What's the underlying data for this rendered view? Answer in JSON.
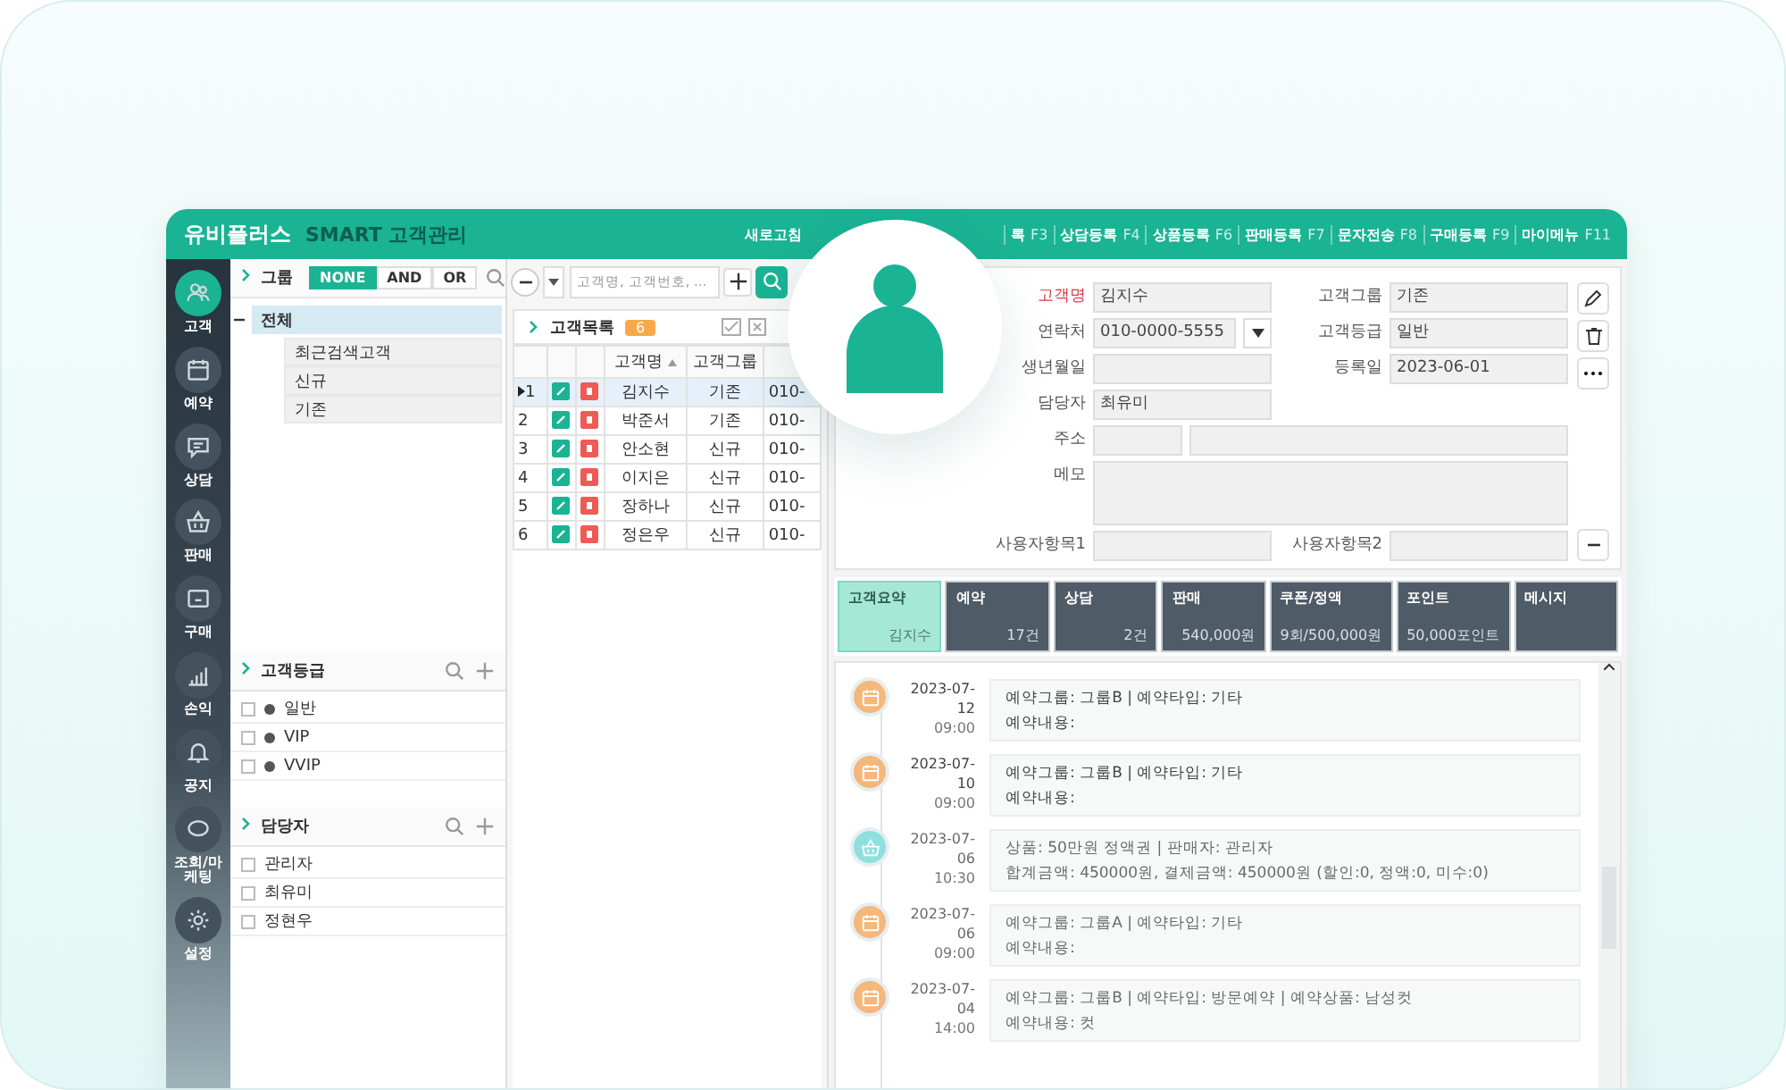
{
  "app": {
    "logo": "유비플러스",
    "subtitle": "SMART 고객관리"
  },
  "top_menu": [
    {
      "label": "새로고침"
    },
    {
      "label": "록",
      "key": "F3"
    },
    {
      "label": "상담등록",
      "key": "F4"
    },
    {
      "label": "상품등록",
      "key": "F6"
    },
    {
      "label": "판매등록",
      "key": "F7"
    },
    {
      "label": "문자전송",
      "key": "F8"
    },
    {
      "label": "구매등록",
      "key": "F9"
    },
    {
      "label": "마이메뉴",
      "key": "F11"
    }
  ],
  "nav": [
    {
      "label": "고객",
      "kind": "people",
      "selected": true
    },
    {
      "label": "예약",
      "kind": "calendar",
      "selected": false
    },
    {
      "label": "상담",
      "kind": "chat",
      "selected": false
    },
    {
      "label": "판매",
      "kind": "basket",
      "selected": false
    },
    {
      "label": "구매",
      "kind": "box",
      "selected": false
    },
    {
      "label": "손익",
      "kind": "chart",
      "selected": false
    },
    {
      "label": "공지",
      "kind": "bell",
      "selected": false
    },
    {
      "label": "조회/마케팅",
      "kind": "sms",
      "selected": false
    },
    {
      "label": "설정",
      "kind": "gear",
      "selected": false
    }
  ],
  "group_panel": {
    "title": "그룹",
    "modes": [
      {
        "label": "NONE",
        "selected": true
      },
      {
        "label": "AND",
        "selected": false
      },
      {
        "label": "OR",
        "selected": false
      }
    ],
    "tree": [
      {
        "label": "전체",
        "selected": true,
        "expanded": true,
        "children": [
          {
            "label": "최근검색고객",
            "selected": false
          },
          {
            "label": "신규",
            "selected": false
          },
          {
            "label": "기존",
            "selected": false
          }
        ]
      }
    ]
  },
  "grade_panel": {
    "title": "고객등급",
    "items": [
      {
        "label": "일반",
        "checked": false,
        "color": "#555555"
      },
      {
        "label": "VIP",
        "checked": false,
        "color": "#555555"
      },
      {
        "label": "VVIP",
        "checked": false,
        "color": "#555555"
      }
    ]
  },
  "manager_panel": {
    "title": "담당자",
    "items": [
      {
        "label": "관리자",
        "checked": false
      },
      {
        "label": "최유미",
        "checked": false
      },
      {
        "label": "정현우",
        "checked": false
      }
    ]
  },
  "search": {
    "placeholder": "고객명, 고객번호, ..."
  },
  "customer_list": {
    "title": "고객목록",
    "count": "6",
    "columns": [
      "고객명",
      "고객그룹"
    ],
    "rows": [
      {
        "no": "1",
        "name": "김지수",
        "group": "기존",
        "column_3": "010-",
        "selected": true
      },
      {
        "no": "2",
        "name": "박준서",
        "group": "기존",
        "column_3": "010-",
        "selected": false
      },
      {
        "no": "3",
        "name": "안소현",
        "group": "신규",
        "column_3": "010-",
        "selected": false
      },
      {
        "no": "4",
        "name": "이지은",
        "group": "신규",
        "column_3": "010-",
        "selected": false
      },
      {
        "no": "5",
        "name": "장하나",
        "group": "신규",
        "column_3": "010-",
        "selected": false
      },
      {
        "no": "6",
        "name": "정은우",
        "group": "신규",
        "column_3": "010-",
        "selected": false
      }
    ]
  },
  "detail": {
    "fields": [
      {
        "label": "고객명",
        "value": "김지수",
        "kind": "text",
        "required": true
      },
      {
        "label": "고객그룹",
        "value": "기존",
        "kind": "text",
        "required": false
      },
      {
        "label": "연락처",
        "value": "010-0000-5555",
        "kind": "phone",
        "required": false
      },
      {
        "label": "고객등급",
        "value": "일반",
        "kind": "text",
        "required": false
      },
      {
        "label": "생년월일",
        "kind": "text",
        "required": false
      },
      {
        "label": "등록일",
        "value": "2023-06-01",
        "kind": "text",
        "required": false
      },
      {
        "label": "담당자",
        "value": "최유미",
        "kind": "text",
        "required": false
      },
      {
        "label": "주소",
        "kind": "address",
        "required": false
      },
      {
        "label": "메모",
        "kind": "memo",
        "required": false
      },
      {
        "label": "사용자항목1",
        "kind": "text",
        "required": false
      },
      {
        "label": "사용자항목2",
        "kind": "text",
        "required": false
      }
    ]
  },
  "summary_tabs": [
    {
      "label": "고객요약",
      "value": "김지수",
      "selected": true
    },
    {
      "label": "예약",
      "value": "17건",
      "selected": false
    },
    {
      "label": "상담",
      "value": "2건",
      "selected": false
    },
    {
      "label": "판매",
      "value": "540,000원",
      "selected": false
    },
    {
      "label": "쿠폰/정액",
      "value": "9회/500,000원",
      "selected": false
    },
    {
      "label": "포인트",
      "value": "50,000포인트",
      "selected": false
    },
    {
      "label": "메시지",
      "selected": false
    }
  ],
  "timeline": [
    {
      "kind": "reservation",
      "date": "2023-07-12",
      "time": "09:00",
      "line1": "예약그룹: 그룹B | 예약타입: 기타",
      "line2": "예약내용:"
    },
    {
      "kind": "reservation",
      "date": "2023-07-10",
      "time": "09:00",
      "line1": "예약그룹: 그룹B | 예약타입: 기타",
      "line2": "예약내용:"
    },
    {
      "kind": "sale",
      "date": "2023-07-06",
      "time": "10:30",
      "line1": "상품: 50만원 정액권 | 판매자: 관리자",
      "line2": "합계금액: 450000원, 결제금액: 450000원 (할인:0, 정액:0, 미수:0)"
    },
    {
      "kind": "reservation",
      "date": "2023-07-06",
      "time": "09:00",
      "line1": "예약그룹: 그룹A | 예약타입: 기타",
      "line2": "예약내용:"
    },
    {
      "kind": "reservation",
      "date": "2023-07-04",
      "time": "14:00",
      "line1": "예약그룹: 그룹B | 예약타입: 방문예약 | 예약상품: 남성컷",
      "line2": "예약내용: 컷"
    }
  ]
}
